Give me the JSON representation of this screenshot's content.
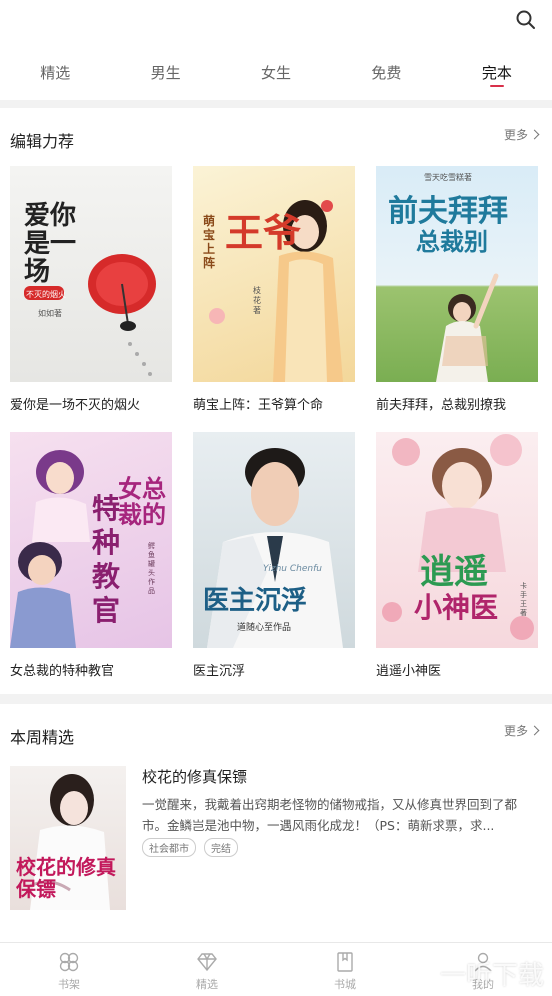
{
  "tabs": [
    {
      "label": "精选"
    },
    {
      "label": "男生"
    },
    {
      "label": "女生"
    },
    {
      "label": "免费"
    },
    {
      "label": "完本"
    }
  ],
  "editor_pick": {
    "title": "编辑力荐",
    "more_label": "更多",
    "books": [
      {
        "title": "爱你是一场不灭的烟火",
        "cover_text": "爱你是一场",
        "cover_sub": "不灭的烟火",
        "author": "如如著"
      },
      {
        "title": "萌宝上阵：王爷算个命",
        "cover_text": "王爷",
        "cover_sub": "萌宝上阵",
        "author": "枝花著"
      },
      {
        "title": "前夫拜拜，总裁别撩我",
        "cover_text": "前夫拜拜",
        "cover_sub": "总裁别",
        "author": "雪天吃雪糕著"
      },
      {
        "title": "女总裁的特种教官",
        "cover_text": "女总裁的",
        "cover_sub": "特种教官",
        "author": "鳄鱼罐头作品"
      },
      {
        "title": "医主沉浮",
        "cover_text": "医主沉浮",
        "cover_sub": "道随心至作品",
        "author": "Yizhu Chenfu"
      },
      {
        "title": "逍遥小神医",
        "cover_text": "逍遥",
        "cover_sub": "小神医",
        "author": "卡手王著"
      }
    ]
  },
  "weekly": {
    "title": "本周精选",
    "more_label": "更多",
    "book": {
      "title": "校花的修真保镖",
      "cover_text": "校花的修真保镖",
      "description": "一觉醒来，我戴着出窍期老怪物的储物戒指，又从修真世界回到了都市。金鳞岂是池中物，一遇风雨化成龙！（PS：萌新求票，求...",
      "tags": [
        "社会都市",
        "完结"
      ]
    }
  },
  "bottom_nav": [
    {
      "label": "书架",
      "icon": "clover-icon"
    },
    {
      "label": "精选",
      "icon": "diamond-icon"
    },
    {
      "label": "书城",
      "icon": "bookmark-icon"
    },
    {
      "label": "我的",
      "icon": "user-icon"
    }
  ],
  "watermark": "一听下载",
  "colors": {
    "accent": "#d8304a"
  }
}
